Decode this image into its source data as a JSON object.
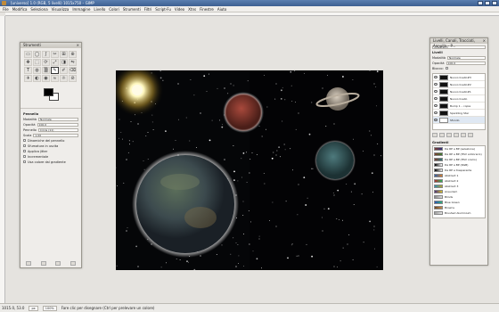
{
  "window": {
    "title": "[universo] 1.0 (RGB, 5 livelli) 1015x750 – GIMP"
  },
  "menubar": {
    "items": [
      "File",
      "Modifica",
      "Seleziona",
      "Visualizza",
      "Immagine",
      "Livello",
      "Colori",
      "Strumenti",
      "Filtri",
      "Script-Fu",
      "Video",
      "Xtns",
      "Finestre",
      "Aiuto"
    ]
  },
  "toolbox": {
    "title": "Strumenti",
    "tool_icons": [
      "▭",
      "◯",
      "ʃ",
      "✂",
      "⊞",
      "⊕",
      "✥",
      "⬚",
      "⟳",
      "⤢",
      "◨",
      "⇋",
      "T",
      "◍",
      "▒",
      "✎",
      "✐",
      "⌫",
      "✈",
      "◐",
      "◉",
      "≈",
      "☼",
      "⊘"
    ],
    "options_title": "Pennello",
    "mode_label": "Modalità",
    "mode_value": "Normale",
    "opacity_label": "Opacità",
    "opacity_value": "100.0",
    "brush_label": "Pennello",
    "brush_value": "Circle (11)",
    "scale_label": "Scala",
    "scale_value": "1.00",
    "checkboxes": [
      "Dinamiche del pennello",
      "Sfumatura in uscita",
      "Applica jitter",
      "Incrementale",
      "Usa colore dal gradiente"
    ]
  },
  "layers": {
    "title": "Livelli, Canali, Tracciati, Annulla – P...",
    "image_select": "universo-1",
    "panel_label": "Livelli",
    "mode_label": "Modalità",
    "mode_value": "Normale",
    "opacity_label": "Opacità",
    "opacity_value": "100.0",
    "lock_label": "Blocco:",
    "items": [
      {
        "name": "Nuovo livello#3",
        "white": false
      },
      {
        "name": "Nuovo livello#2",
        "white": false
      },
      {
        "name": "Nuovo livello#1",
        "white": false
      },
      {
        "name": "Nuovo livello",
        "white": false
      },
      {
        "name": "Bump 1 – copia",
        "white": false
      },
      {
        "name": "Sparkling Star",
        "white": false
      },
      {
        "name": "Sfondo",
        "white": true
      }
    ],
    "gradients_label": "Gradienti",
    "gradients": [
      {
        "name": "Da RP a BP (selezione)",
        "c1": "#7a3b2f",
        "c2": "#2f2f7a"
      },
      {
        "name": "Da RP a BP (HSV antiorario)",
        "c1": "#7a3b2f",
        "c2": "#3b7a2f"
      },
      {
        "name": "Da RP a BP (HSV orario)",
        "c1": "#7a3b2f",
        "c2": "#2f7a7a"
      },
      {
        "name": "Da RP a BP (RGB)",
        "c1": "#000000",
        "c2": "#ffffff"
      },
      {
        "name": "Da RP a trasparente",
        "c1": "#000000",
        "c2": "#eeeeee"
      },
      {
        "name": "Abstract 1",
        "c1": "#2b5fa8",
        "c2": "#d67b2c"
      },
      {
        "name": "Abstract 2",
        "c1": "#b32c2c",
        "c2": "#2cb35a"
      },
      {
        "name": "Abstract 3",
        "c1": "#2c8cb3",
        "c2": "#b3a42c"
      },
      {
        "name": "Aneurism",
        "c1": "#4a2c7a",
        "c2": "#d6c22c"
      },
      {
        "name": "Blinds",
        "c1": "#888888",
        "c2": "#dddddd"
      },
      {
        "name": "Blue Green",
        "c1": "#2c4fb3",
        "c2": "#2cb37a"
      },
      {
        "name": "Browns",
        "c1": "#6b4426",
        "c2": "#c48c4d"
      },
      {
        "name": "Brushed Aluminium",
        "c1": "#9c9c9c",
        "c2": "#e6e6e6"
      }
    ]
  },
  "statusbar": {
    "coords": "1015.0, 53.0",
    "unit": "px",
    "zoom": "100%",
    "message": "Fare clic per disegnare (Ctrl per prelevare un colore)"
  },
  "colors": {
    "foreground": "#000000",
    "background": "#ffffff",
    "title_bar": "#3d5f91"
  }
}
